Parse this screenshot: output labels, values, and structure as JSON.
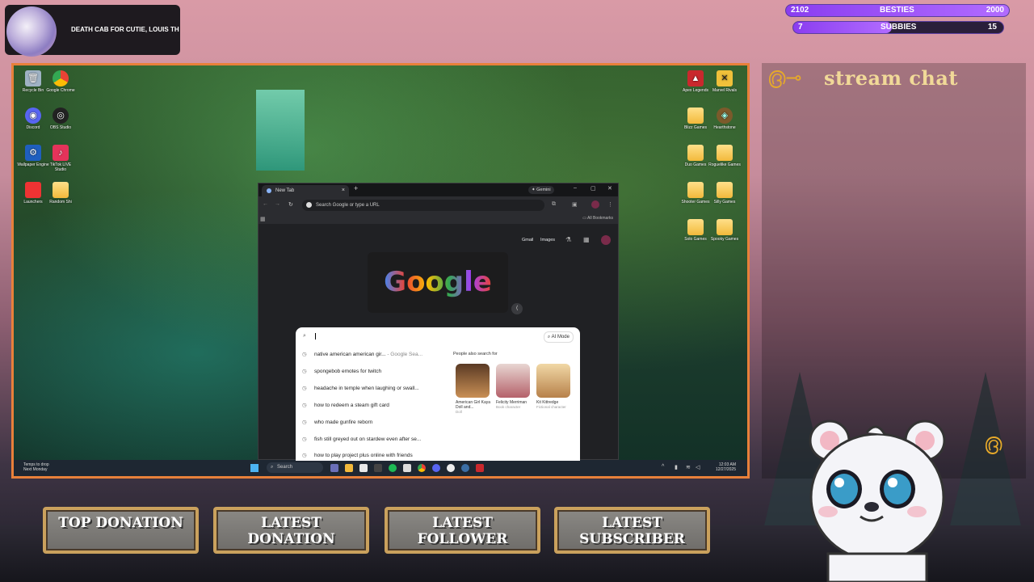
{
  "now_playing": {
    "text": "DEATH CAB FOR CUTIE, LOUIS TH"
  },
  "goals": [
    {
      "current": "2102",
      "label": "BESTIES",
      "target": "2000",
      "progress": 1.0
    },
    {
      "current": "7",
      "label": "SUBBIES",
      "target": "15",
      "progress": 0.47
    }
  ],
  "desktop": {
    "left_icons": [
      {
        "label": "Recycle Bin",
        "icon": "recycle-bin-icon"
      },
      {
        "label": "Google Chrome",
        "icon": "chrome-icon"
      },
      {
        "label": "Discord",
        "icon": "discord-icon"
      },
      {
        "label": "OBS Studio",
        "icon": "obs-icon"
      },
      {
        "label": "Wallpaper Engine",
        "icon": "wallpaper-engine-icon"
      },
      {
        "label": "TikTok LIVE Studio",
        "icon": "tiktok-icon"
      },
      {
        "label": "Launchers",
        "icon": "folder-icon"
      },
      {
        "label": "Random Shi",
        "icon": "folder-icon"
      }
    ],
    "right_icons": [
      {
        "label": "Apex Legends",
        "icon": "apex-icon"
      },
      {
        "label": "Marvel Rivals",
        "icon": "marvel-rivals-icon"
      },
      {
        "label": "Blizz Games",
        "icon": "folder-icon"
      },
      {
        "label": "Hearthstone",
        "icon": "hearthstone-icon"
      },
      {
        "label": "Duo Games",
        "icon": "folder-icon"
      },
      {
        "label": "Roguelike Games",
        "icon": "folder-icon"
      },
      {
        "label": "Shooter Games",
        "icon": "folder-icon"
      },
      {
        "label": "Silly Games",
        "icon": "folder-icon"
      },
      {
        "label": "Solo Games",
        "icon": "folder-icon"
      },
      {
        "label": "Spooky Games",
        "icon": "folder-icon"
      }
    ]
  },
  "browser": {
    "tab_title": "New Tab",
    "gemini_label": "Gemini",
    "omnibox_placeholder": "Search Google or type a URL",
    "all_bookmarks": "All Bookmarks",
    "links": {
      "gmail": "Gmail",
      "images": "Images"
    },
    "logo_text": "Google",
    "ai_mode": "AI Mode",
    "suggestions": [
      {
        "text": "native american american gir...",
        "extra": " - Google Sea..."
      },
      {
        "text": "spongebob emotes for twitch",
        "extra": ""
      },
      {
        "text": "headache in temple when laughing or swall...",
        "extra": ""
      },
      {
        "text": "how to redeem a steam gift card",
        "extra": ""
      },
      {
        "text": "who made gunfire reborn",
        "extra": ""
      },
      {
        "text": "fish still greyed out on stardew even after se...",
        "extra": ""
      },
      {
        "text": "how to play project plus online with friends",
        "extra": ""
      }
    ],
    "people_also_search": "People also search for",
    "cards": [
      {
        "name": "American Girl Kaya Doll and...",
        "sub": "Doll",
        "color": "#c98f55"
      },
      {
        "name": "Felicity Merriman",
        "sub": "Book character",
        "color": "#d9b6b8"
      },
      {
        "name": "Kit Kittredge",
        "sub": "Fictional character",
        "color": "#e6c28a"
      }
    ]
  },
  "taskbar": {
    "weather_line1": "Temps to drop",
    "weather_line2": "Next Monday",
    "search_label": "Search",
    "time": "12:03 AM",
    "date": "12/27/2025"
  },
  "chat": {
    "title": "stream chat"
  },
  "plaques": {
    "top_donation": "TOP DONATION",
    "latest_donation": "LATEST DONATION",
    "latest_follower": "LATEST FOLLOWER",
    "latest_subscriber": "LATEST SUBSCRIBER"
  },
  "colors": {
    "frame_border": "#e8803a",
    "goal_fill": "#8a3df0",
    "chat_title": "#f1d998",
    "plaque_border": "#caa15d"
  }
}
